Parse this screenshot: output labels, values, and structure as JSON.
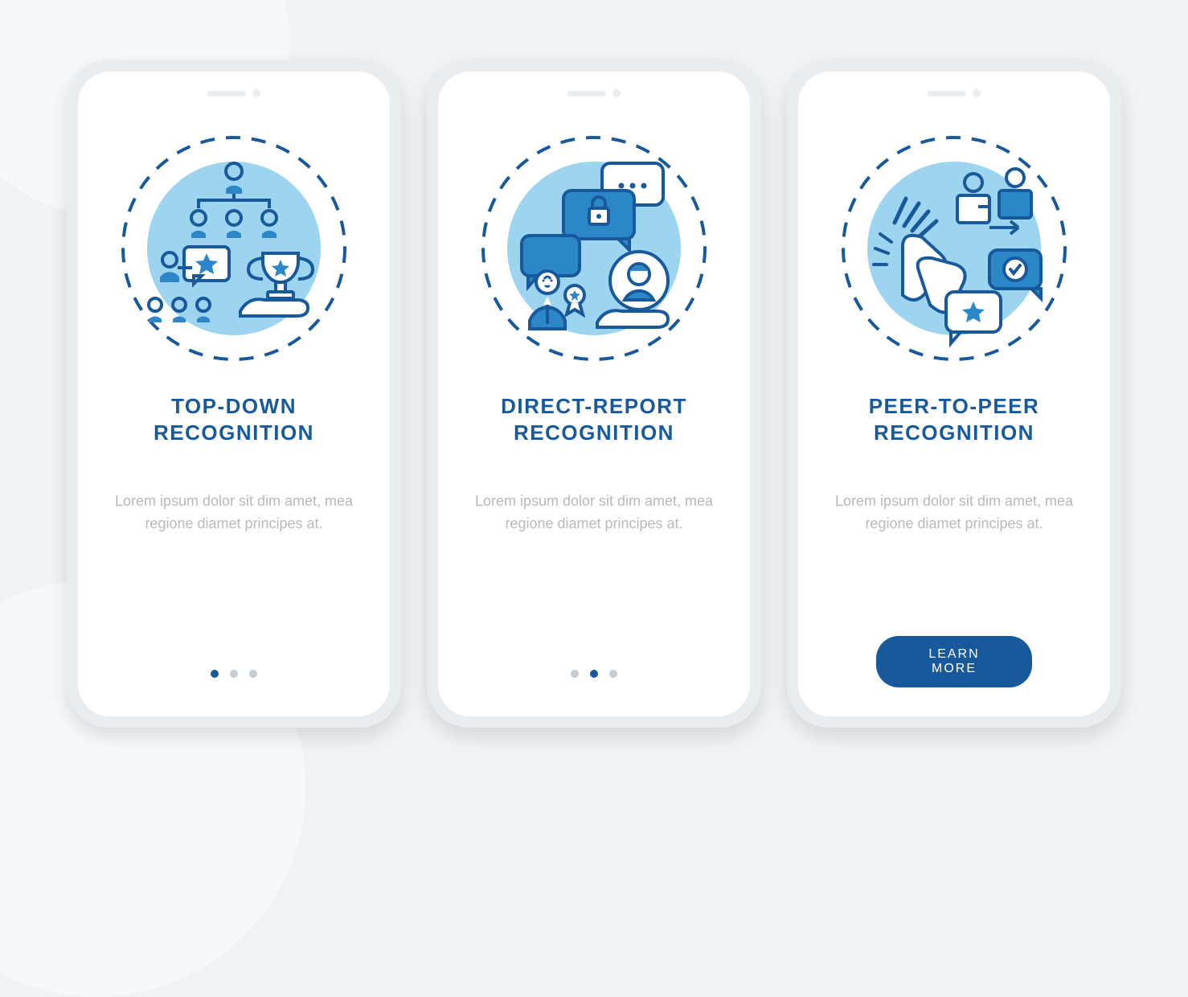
{
  "colors": {
    "primary": "#18599b",
    "accent_light": "#9dd4f0",
    "icon_fill": "#2b87c8",
    "muted": "#b7b9bb"
  },
  "screens": [
    {
      "id": "top-down",
      "title": "TOP-DOWN\nRECOGNITION",
      "description": "Lorem ipsum dolor sit dim amet, mea regione diamet principes at.",
      "icon": "top-down-recognition-illustration",
      "pager_active": 0,
      "has_cta": false
    },
    {
      "id": "direct-report",
      "title": "DIRECT-REPORT\nRECOGNITION",
      "description": "Lorem ipsum dolor sit dim amet, mea regione diamet principes at.",
      "icon": "direct-report-recognition-illustration",
      "pager_active": 1,
      "has_cta": false
    },
    {
      "id": "peer-to-peer",
      "title": "PEER-TO-PEER\nRECOGNITION",
      "description": "Lorem ipsum dolor sit dim amet, mea regione diamet principes at.",
      "icon": "peer-to-peer-recognition-illustration",
      "pager_active": 2,
      "has_cta": true
    }
  ],
  "cta_label": "LEARN MORE",
  "pager_count": 3
}
